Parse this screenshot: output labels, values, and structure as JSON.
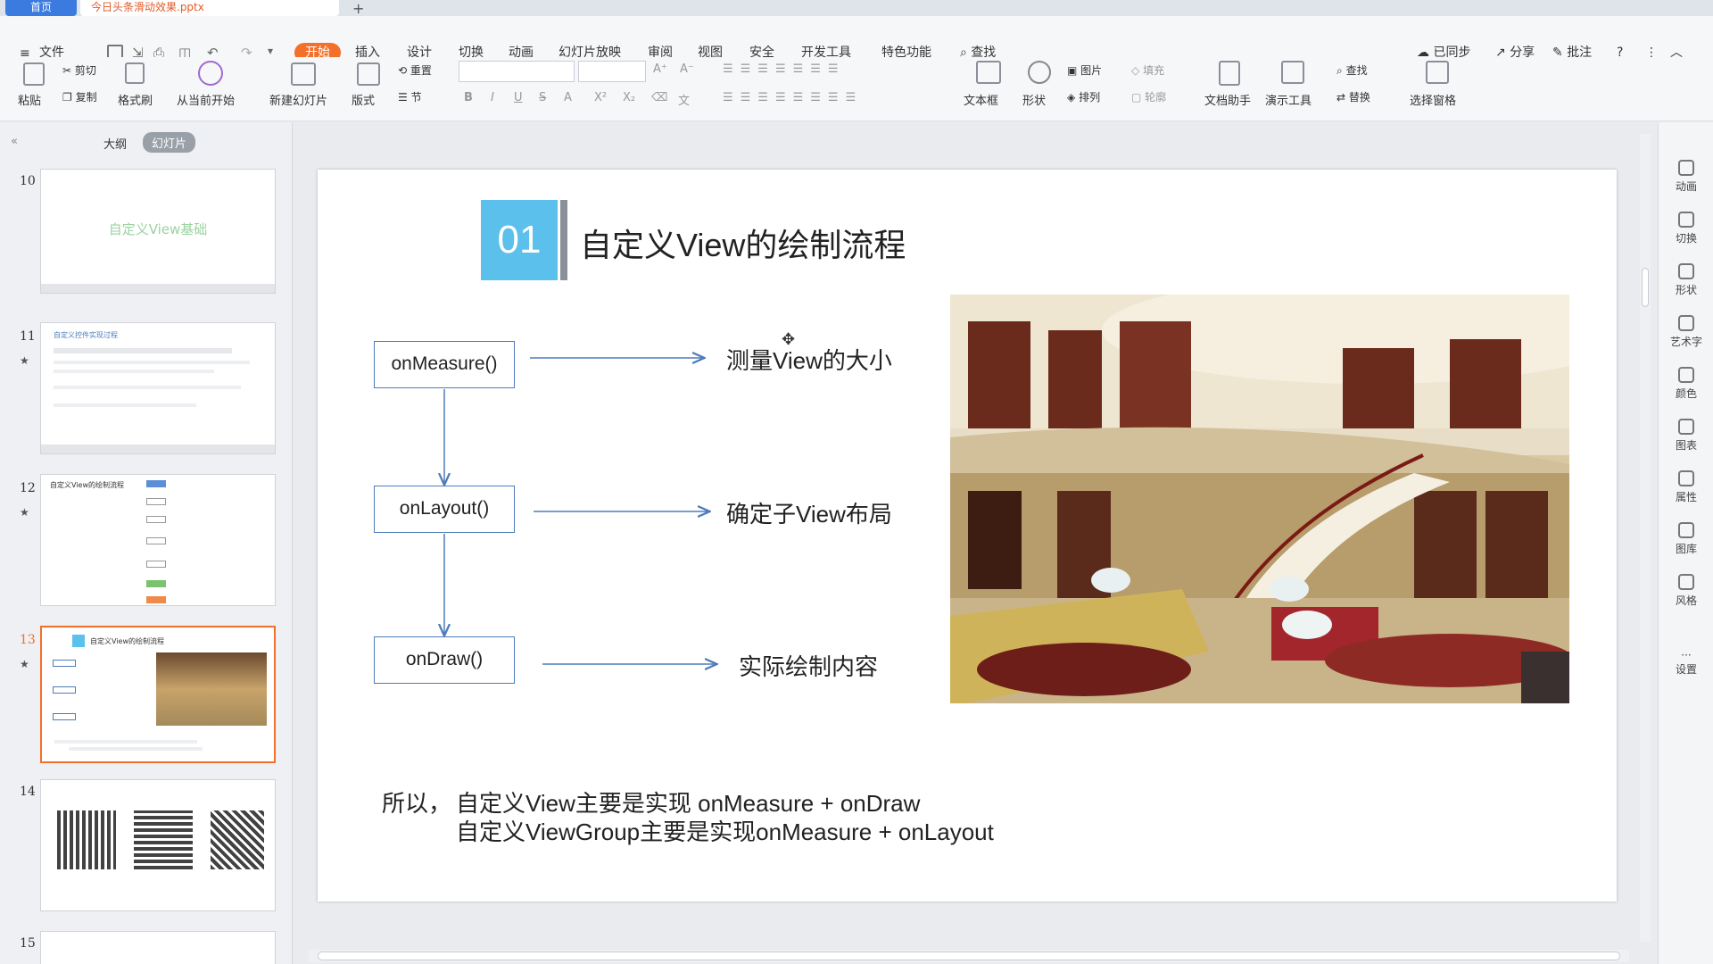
{
  "tabs": {
    "home": "首页",
    "doc": "今日头条滑动效果.pptx"
  },
  "menu": [
    "文件",
    "开始",
    "插入",
    "设计",
    "切换",
    "动画",
    "幻灯片放映",
    "审阅",
    "视图",
    "安全",
    "开发工具",
    "特色功能",
    "查找"
  ],
  "menu_right": {
    "sync": "已同步",
    "share": "分享",
    "comment": "批注"
  },
  "ribbon": {
    "paste": "粘贴",
    "cut": "剪切",
    "copy": "复制",
    "format_painter": "格式刷",
    "from_current": "从当前开始",
    "new_slide": "新建幻灯片",
    "layout": "版式",
    "reset": "重置",
    "section": "节",
    "textbox": "文本框",
    "shape": "形状",
    "picture": "图片",
    "fill": "填充",
    "arrange": "排列",
    "outline": "轮廓",
    "doc_helper": "文档助手",
    "present_tool": "演示工具",
    "find": "查找",
    "replace": "替换",
    "select_pane": "选择窗格"
  },
  "panel_tabs": {
    "outline": "大纲",
    "slides": "幻灯片"
  },
  "thumbnails": [
    {
      "num": "10",
      "title": "自定义View基础"
    },
    {
      "num": "11",
      "title": "自定义控件实现过程"
    },
    {
      "num": "12",
      "title": "自定义View的绘制流程"
    },
    {
      "num": "13",
      "title": "自定义View的绘制流程"
    },
    {
      "num": "14",
      "title": ""
    },
    {
      "num": "15",
      "title": ""
    }
  ],
  "slide": {
    "badge": "01",
    "title": "自定义View的绘制流程",
    "nodes": [
      "onMeasure()",
      "onLayout()",
      "onDraw()"
    ],
    "descriptions": [
      "测量View的大小",
      "确定子View布局",
      "实际绘制内容"
    ],
    "note_prefix": "所以，",
    "note_line1": "自定义View主要是实现 onMeasure + onDraw",
    "note_line2": "自定义ViewGroup主要是实现onMeasure + onLayout"
  },
  "right_tools": [
    "动画",
    "切换",
    "形状",
    "艺术字",
    "颜色",
    "图表",
    "属性",
    "图库",
    "风格",
    "设置"
  ],
  "colors": {
    "accent": "#f36f2a",
    "badge": "#5bc0eb",
    "node_border": "#4e7cba",
    "selected_thumb": "#f36f2a"
  }
}
